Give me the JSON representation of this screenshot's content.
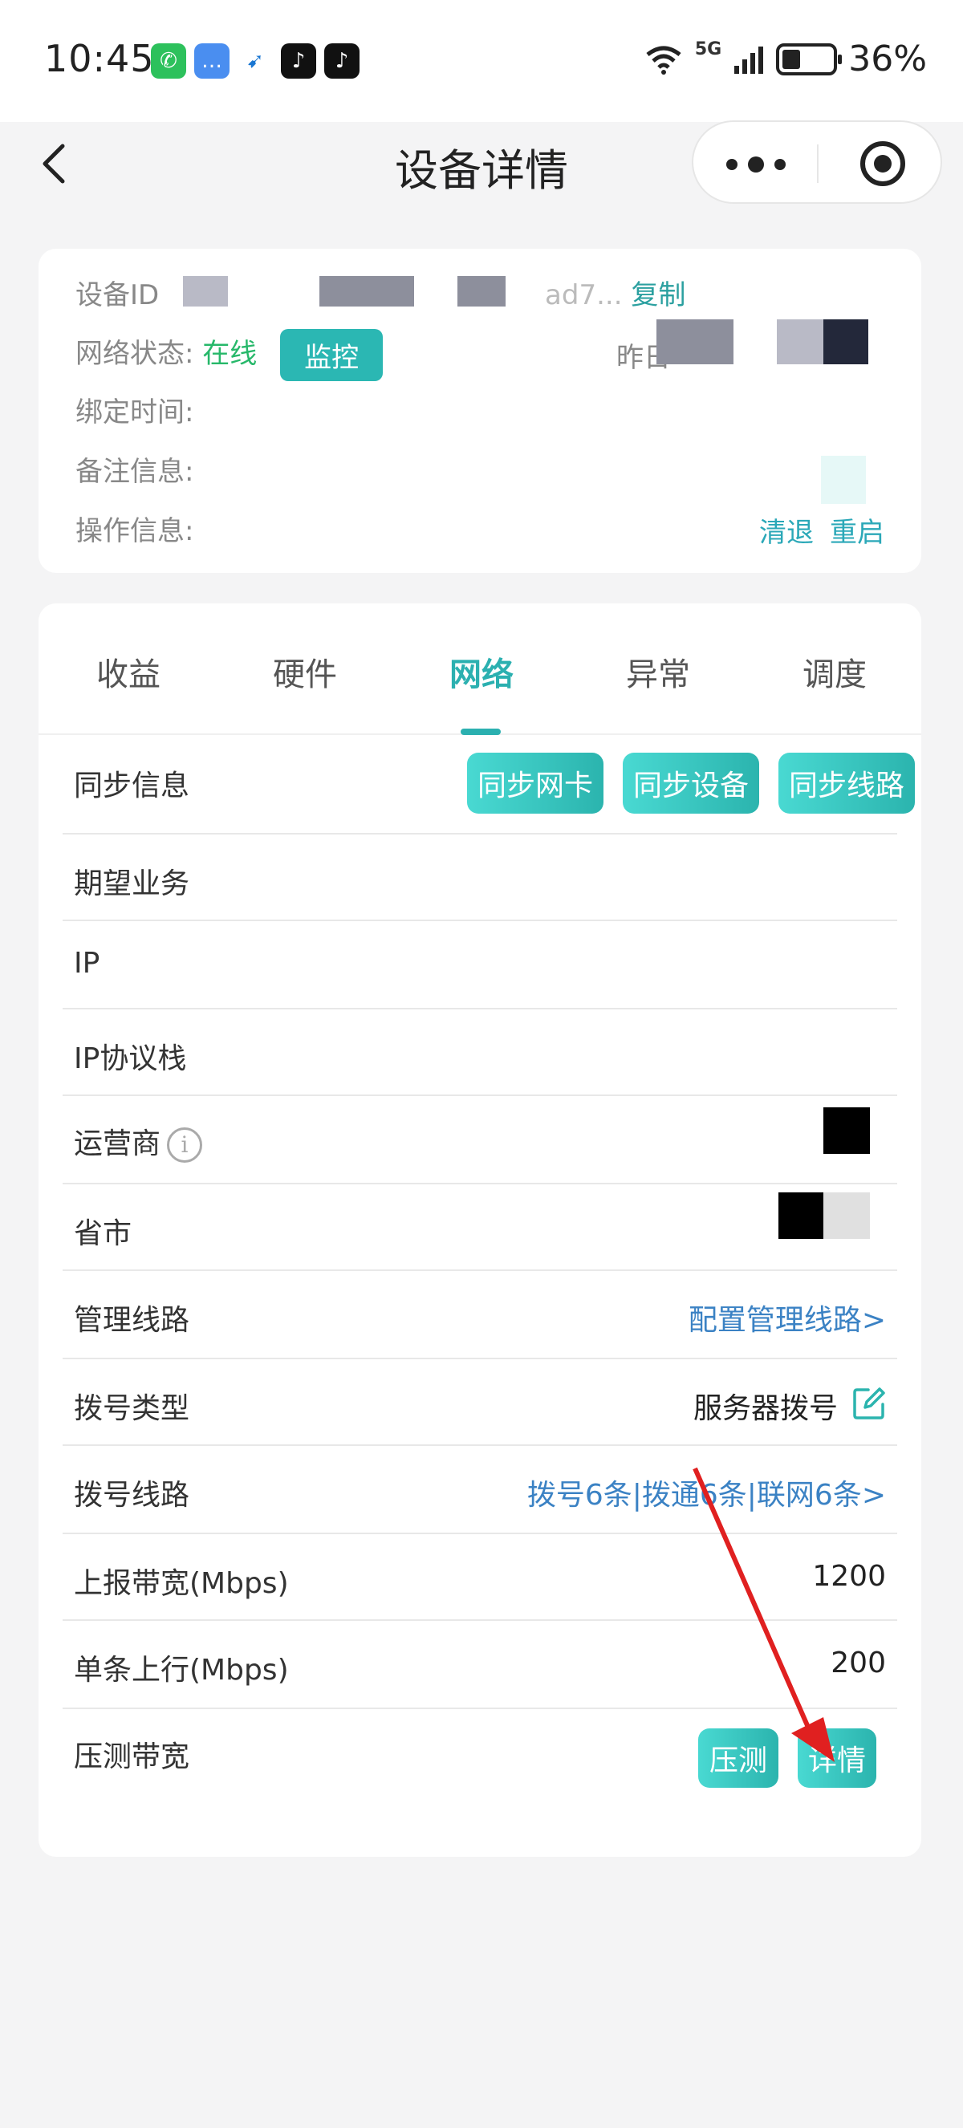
{
  "status_bar": {
    "time": "10:45",
    "network": "5G",
    "battery_percent": "36%",
    "apps": [
      "wechat-icon",
      "message-icon",
      "bird-icon",
      "tiktok-icon",
      "tiktok-icon"
    ]
  },
  "nav": {
    "title": "设备详情"
  },
  "device_info": {
    "id_label": "设备ID",
    "id_tail": "ad7...",
    "copy": "复制",
    "network_status_label": "网络状态:",
    "network_status_value": "在线",
    "monitor_btn": "监控",
    "yesterday_label": "昨日",
    "bind_time_label": "绑定时间:",
    "note_label": "备注信息:",
    "operation_label": "操作信息:",
    "op_clear": "清退",
    "op_restart": "重启"
  },
  "tabs": [
    "收益",
    "硬件",
    "网络",
    "异常",
    "调度"
  ],
  "active_tab": "网络",
  "network": {
    "sync_label": "同步信息",
    "sync_buttons": [
      "同步网卡",
      "同步设备",
      "同步线路"
    ],
    "rows": {
      "expected_business": "期望业务",
      "ip": "IP",
      "ip_stack": "IP协议栈",
      "carrier": "运营商",
      "province_city": "省市",
      "mgmt_route_label": "管理线路",
      "mgmt_route_link": "配置管理线路>",
      "dial_type_label": "拨号类型",
      "dial_type_value": "服务器拨号",
      "dial_route_label": "拨号线路",
      "dial_route_link": "拨号6条|拨通6条|联网6条>",
      "report_bw_label": "上报带宽(Mbps)",
      "report_bw_value": "1200",
      "single_up_label": "单条上行(Mbps)",
      "single_up_value": "200",
      "stress_label": "压测带宽",
      "stress_btn": "压测",
      "detail_btn": "详情"
    }
  },
  "colors": {
    "accent": "#2bb0b0",
    "online": "#27b86a",
    "link": "#3b82c4",
    "annotation_arrow": "#e02020"
  }
}
